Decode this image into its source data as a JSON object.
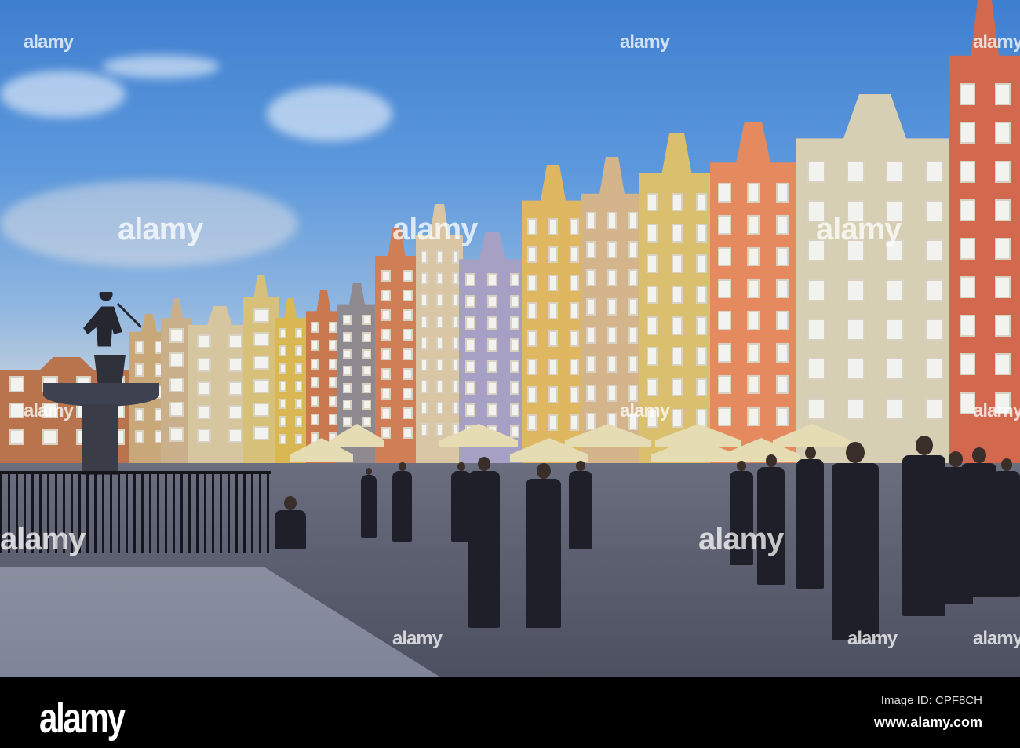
{
  "photo": {
    "watermarks": [
      "alamy",
      "alamy",
      "alamy",
      "alamy",
      "alamy",
      "alamy",
      "alamy",
      "alamy",
      "alamy",
      "alamy",
      "alamy",
      "alamy",
      "alamy",
      "alamy"
    ]
  },
  "footer": {
    "logo": "alamy",
    "image_id": "Image ID: CPF8CH",
    "url": "www.alamy.com"
  },
  "colors": {
    "sky_top": "#3f7fd0",
    "building_orange": "#e58a5e",
    "building_yellow": "#d9b45a",
    "umbrella": "#e6dcb4"
  }
}
